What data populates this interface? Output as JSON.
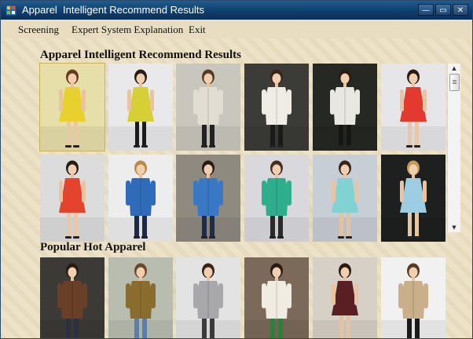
{
  "window": {
    "title": "Apparel  Intelligent Recommend Results",
    "controls": [
      {
        "name": "minimize-button",
        "glyph": "—"
      },
      {
        "name": "maximize-button",
        "glyph": "▭"
      },
      {
        "name": "close-button",
        "glyph": "✕"
      }
    ]
  },
  "menu": {
    "items": [
      {
        "label": "Screening"
      },
      {
        "label": "Expert System Explanation"
      },
      {
        "label": "Exit"
      }
    ]
  },
  "recommend": {
    "title": "Apparel Intelligent Recommend Results",
    "items": [
      {
        "bg": "#e7dfaa",
        "garment": "#e8d12e",
        "hair": "#6b3a1e",
        "legs": "#e8c9a6",
        "style": "dress"
      },
      {
        "bg": "#e9e9eb",
        "garment": "#d6cf35",
        "hair": "#2a1a14",
        "legs": "#1b1b1b",
        "style": "dress"
      },
      {
        "bg": "#c9c6be",
        "garment": "#e1ddd2",
        "hair": "#5a3a22",
        "legs": "#222222",
        "style": "coat"
      },
      {
        "bg": "#3b3b38",
        "garment": "#efece6",
        "hair": "#3a2418",
        "legs": "#1a1a1a",
        "style": "coat"
      },
      {
        "bg": "#262923",
        "garment": "#e9e7e2",
        "hair": "#2b1b12",
        "legs": "#151515",
        "style": "coat"
      },
      {
        "bg": "#e6e6e8",
        "garment": "#e23a2f",
        "hair": "#2a1a14",
        "legs": "#e6c7a8",
        "style": "dress"
      },
      {
        "bg": "#dcdcdd",
        "garment": "#e4442e",
        "hair": "#2a1a14",
        "legs": "#e8c8a6",
        "style": "dress"
      },
      {
        "bg": "#ededee",
        "garment": "#2f6bb8",
        "hair": "#b88a4a",
        "legs": "#1c2a45",
        "style": "coat"
      },
      {
        "bg": "#8f8a80",
        "garment": "#3a78c6",
        "hair": "#2a1a14",
        "legs": "#1f2c47",
        "style": "coat"
      },
      {
        "bg": "#d9d9dd",
        "garment": "#2fae8e",
        "hair": "#4a2e1c",
        "legs": "#2a2a2a",
        "style": "coat"
      },
      {
        "bg": "#c8ced6",
        "garment": "#82d1d3",
        "hair": "#3a2418",
        "legs": "#e1c3a2",
        "style": "dress"
      },
      {
        "bg": "#1e1f1f",
        "garment": "#9ccde2",
        "hair": "#c59a58",
        "legs": "#e4c6a4",
        "style": "dress"
      }
    ]
  },
  "popular": {
    "title": "Popular Hot Apparel",
    "items": [
      {
        "bg": "#3c3a36",
        "garment": "#6a3f27",
        "hair": "#2a1a14",
        "legs": "#2b3140",
        "style": "coat"
      },
      {
        "bg": "#b9bdb0",
        "garment": "#8a6d2e",
        "hair": "#6b4a2a",
        "legs": "#5d7fa6",
        "style": "coat"
      },
      {
        "bg": "#e3e3e4",
        "garment": "#a8a8aa",
        "hair": "#3a2418",
        "legs": "#3a3a3a",
        "style": "coat"
      },
      {
        "bg": "#7b6a5a",
        "garment": "#f0ece2",
        "hair": "#2a1a14",
        "legs": "#2f7f3a",
        "style": "coat"
      },
      {
        "bg": "#d7d0c6",
        "garment": "#5a1f22",
        "hair": "#2a1a14",
        "legs": "#e1c2a2",
        "style": "dress"
      },
      {
        "bg": "#f1f1f1",
        "garment": "#c9b08a",
        "hair": "#5a3a22",
        "legs": "#1a1a1a",
        "style": "coat"
      }
    ]
  },
  "scrollbar": {
    "up_glyph": "▲",
    "down_glyph": "▼"
  }
}
